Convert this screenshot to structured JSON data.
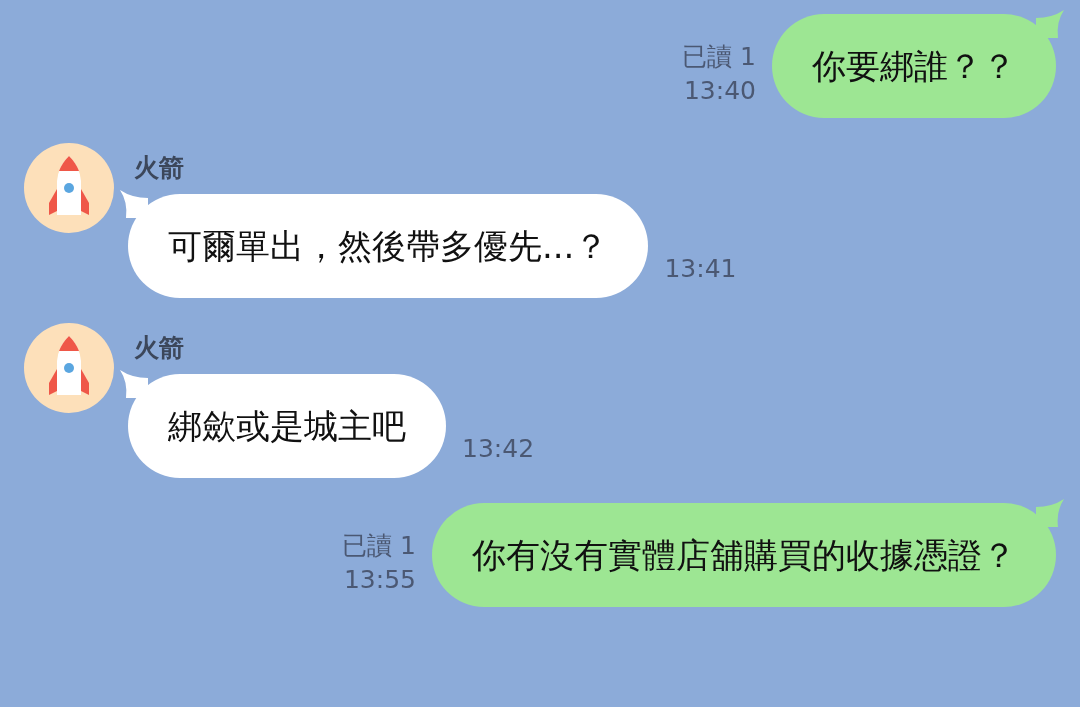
{
  "messages": [
    {
      "kind": "outgoing",
      "text": "你要綁誰？？",
      "read": "已讀 1",
      "time": "13:40"
    },
    {
      "kind": "incoming",
      "sender": "火箭",
      "text": "可爾單出，然後帶多優先...？",
      "time": "13:41"
    },
    {
      "kind": "incoming",
      "sender": "火箭",
      "text": "綁歛或是城主吧",
      "time": "13:42"
    },
    {
      "kind": "outgoing",
      "text": "你有沒有實體店舖購買的收據憑證？",
      "read": "已讀 1",
      "time": "13:55"
    }
  ]
}
